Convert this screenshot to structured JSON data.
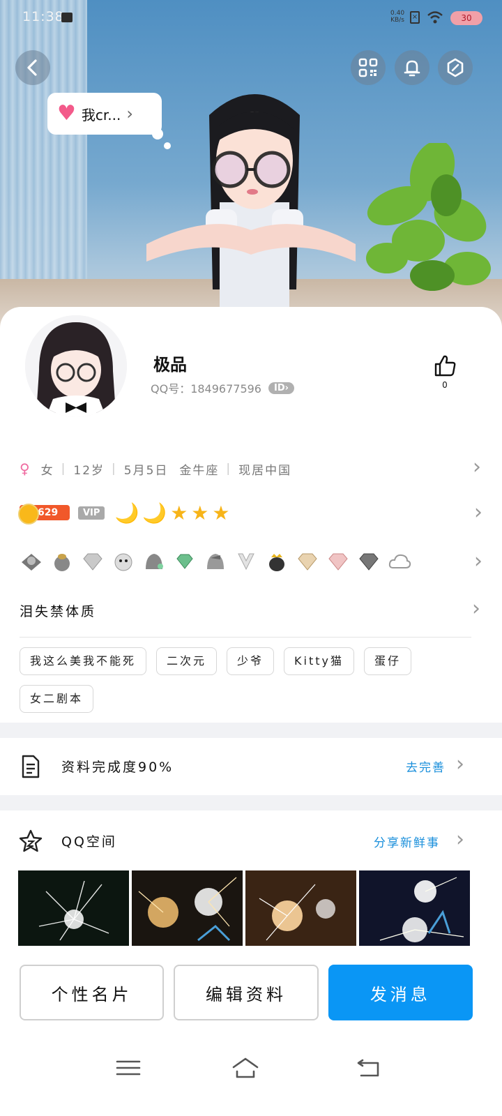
{
  "status_bar": {
    "time": "11:38",
    "net_speed_value": "0.40",
    "net_speed_unit": "KB/s",
    "battery": "30"
  },
  "hero": {
    "bubble_text": "我cr...",
    "bubble_chevron": "›"
  },
  "profile": {
    "nickname": "极品",
    "qq_label": "QQ号：1849677596",
    "id_badge": "ID›",
    "like_count": "0"
  },
  "info": {
    "gender_symbol": "♀",
    "gender": "女",
    "age": "12岁",
    "birthday": "5月5日",
    "zodiac": "金牛座",
    "location": "现居中国"
  },
  "level": {
    "coin_value": "629",
    "vip_label": "VIP",
    "icons": [
      "🌙",
      "🌙",
      "★",
      "★",
      "★"
    ]
  },
  "signature": "泪失禁体质",
  "tags": [
    "我这么美我不能死",
    "二次元",
    "少爷",
    "Kitty猫",
    "蛋仔",
    "女二剧本"
  ],
  "completion": {
    "label": "资料完成度90%",
    "action": "去完善"
  },
  "qzone": {
    "label": "QQ空间",
    "action": "分享新鲜事"
  },
  "buttons": {
    "card": "个性名片",
    "edit": "编辑资料",
    "message": "发消息"
  },
  "chevron": "›",
  "colors": {
    "accent": "#0a96f5",
    "link": "#1a8fdb"
  }
}
